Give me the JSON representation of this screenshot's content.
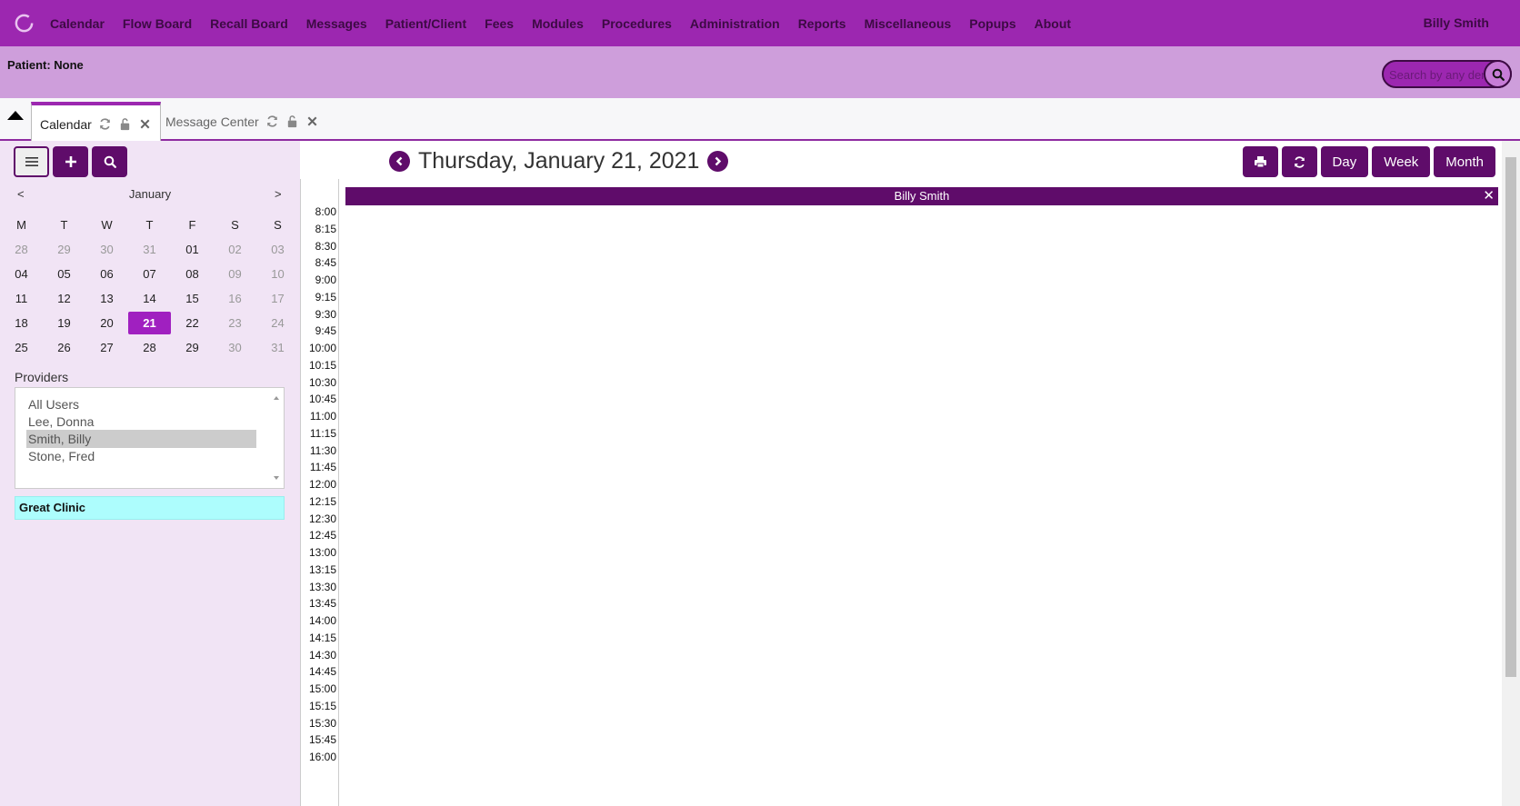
{
  "nav": {
    "items": [
      "Calendar",
      "Flow Board",
      "Recall Board",
      "Messages",
      "Patient/Client",
      "Fees",
      "Modules",
      "Procedures",
      "Administration",
      "Reports",
      "Miscellaneous",
      "Popups",
      "About"
    ],
    "user": "Billy Smith"
  },
  "patient_bar": {
    "label": "Patient: None",
    "search_placeholder": "Search by any demographics"
  },
  "tabs": [
    {
      "label": "Calendar",
      "active": true
    },
    {
      "label": "Message Center",
      "active": false
    }
  ],
  "calendar": {
    "date_title": "Thursday, January 21, 2021",
    "view_buttons": [
      "Day",
      "Week",
      "Month"
    ],
    "provider_column": "Billy Smith",
    "close_label": "✕",
    "times": [
      "8:00",
      "8:15",
      "8:30",
      "8:45",
      "9:00",
      "9:15",
      "9:30",
      "9:45",
      "10:00",
      "10:15",
      "10:30",
      "10:45",
      "11:00",
      "11:15",
      "11:30",
      "11:45",
      "12:00",
      "12:15",
      "12:30",
      "12:45",
      "13:00",
      "13:15",
      "13:30",
      "13:45",
      "14:00",
      "14:15",
      "14:30",
      "14:45",
      "15:00",
      "15:15",
      "15:30",
      "15:45",
      "16:00"
    ]
  },
  "mini_calendar": {
    "prev": "<",
    "month": "January",
    "next": ">",
    "weekdays": [
      "M",
      "T",
      "W",
      "T",
      "F",
      "S",
      "S"
    ],
    "weeks": [
      [
        "28",
        "29",
        "30",
        "31",
        "01",
        "02",
        "03"
      ],
      [
        "04",
        "05",
        "06",
        "07",
        "08",
        "09",
        "10"
      ],
      [
        "11",
        "12",
        "13",
        "14",
        "15",
        "16",
        "17"
      ],
      [
        "18",
        "19",
        "20",
        "21",
        "22",
        "23",
        "24"
      ],
      [
        "25",
        "26",
        "27",
        "28",
        "29",
        "30",
        "31"
      ]
    ],
    "selected": "21"
  },
  "providers": {
    "label": "Providers",
    "items": [
      "All Users",
      "Lee, Donna",
      "Smith, Billy",
      "Stone, Fred"
    ],
    "selected": "Smith, Billy"
  },
  "facility": "Great Clinic",
  "colors": {
    "nav_bg": "#9c27b0",
    "patient_bar_bg": "#ce9edb",
    "button_bg": "#5f0c6a",
    "selected_day": "#a020c0",
    "facility_bg": "#adfdfd",
    "sidebar_bg": "#f1e4f5"
  }
}
